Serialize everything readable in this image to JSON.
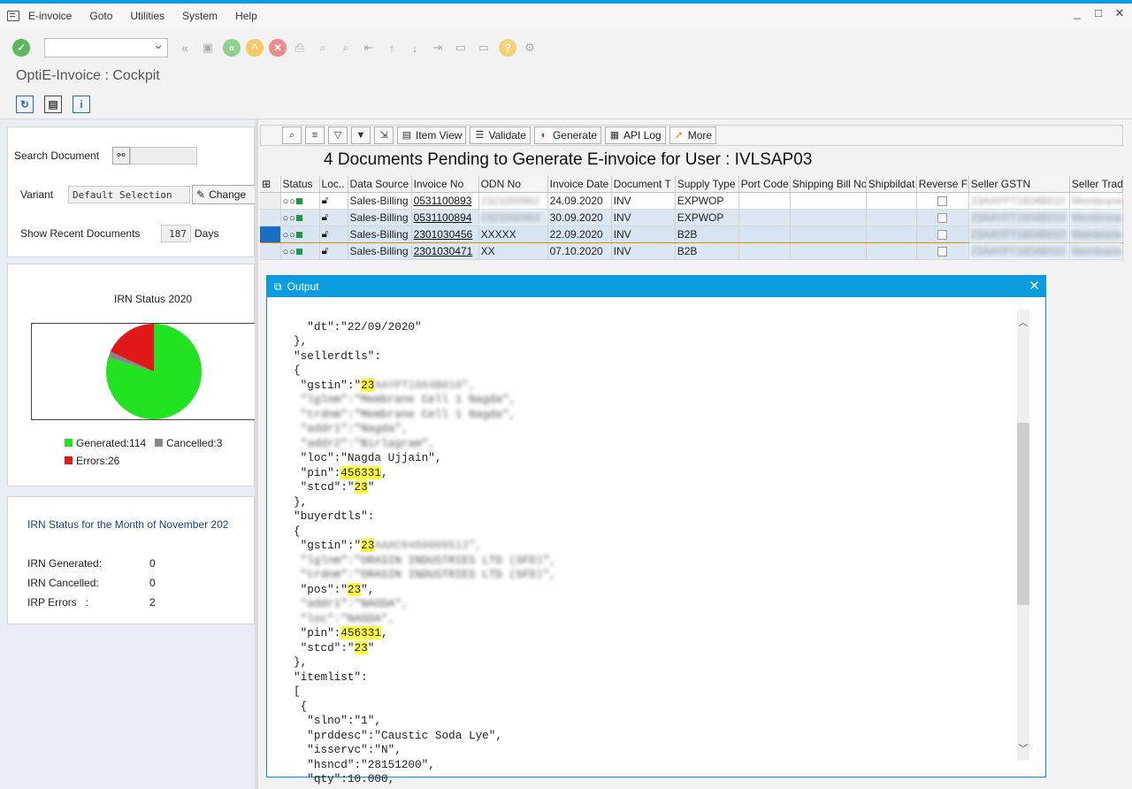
{
  "menu": {
    "items": [
      "E-invoice",
      "Goto",
      "Utilities",
      "System",
      "Help"
    ]
  },
  "window_controls": [
    "_",
    "□",
    "✕"
  ],
  "app_title": "OptiE-Invoice : Cockpit",
  "search": {
    "search_document_label": "Search Document",
    "variant_label": "Variant",
    "variant_value": "Default Selection",
    "change_label": "Change",
    "recent_label": "Show Recent Documents",
    "recent_value": "187",
    "days_label": "Days"
  },
  "irn_chart": {
    "legend_generated": "Generated:114",
    "legend_cancelled": "Cancelled:3",
    "legend_errors": "Errors:26"
  },
  "chart_data": {
    "type": "pie",
    "title": "IRN Status 2020",
    "series": [
      {
        "name": "Generated",
        "value": 114,
        "color": "#22e322"
      },
      {
        "name": "Cancelled",
        "value": 3,
        "color": "#888888"
      },
      {
        "name": "Errors",
        "value": 26,
        "color": "#e01818"
      }
    ]
  },
  "month_status": {
    "title": "IRN Status for the Month of November 202",
    "generated_label": "IRN Generated:",
    "generated_value": "0",
    "cancelled_label": "IRN Cancelled:",
    "cancelled_value": "0",
    "errors_label": "IRP Errors   :",
    "errors_value": "2"
  },
  "alv_toolbar": {
    "item_view": "Item View",
    "validate": "Validate",
    "generate": "Generate",
    "api_log": "API Log",
    "more": "More"
  },
  "grid": {
    "title": "4 Documents Pending to Generate E-invoice for User : IVLSAP03",
    "columns": [
      "Status",
      "Loc..",
      "Data Source",
      "Invoice No",
      "ODN No",
      "Invoice Date",
      "Document T",
      "Supply Type",
      "Port Code",
      "Shipping Bill No",
      "Shipbildat",
      "Reverse Fl",
      "Seller GSTN",
      "Seller Trad"
    ],
    "rows": [
      {
        "source": "Sales-Billing",
        "invoice": "0531100893",
        "odn": "2321000962",
        "date": "24.09.2020",
        "doc": "INV",
        "supply": "EXPWOP",
        "gstn": "23AAYPT1804B010",
        "trade": "Membrane"
      },
      {
        "source": "Sales-Billing",
        "invoice": "0531100894",
        "odn": "2321000963",
        "date": "30.09.2020",
        "doc": "INV",
        "supply": "EXPWOP",
        "gstn": "23AAYPT1804B010",
        "trade": "Membrane"
      },
      {
        "source": "Sales-Billing",
        "invoice": "2301030456",
        "odn": "XXXXX",
        "date": "22.09.2020",
        "doc": "INV",
        "supply": "B2B",
        "gstn": "23AAYPT1804B010",
        "trade": "Membrane"
      },
      {
        "source": "Sales-Billing",
        "invoice": "2301030471",
        "odn": "XX",
        "date": "07.10.2020",
        "doc": "INV",
        "supply": "B2B",
        "gstn": "23AAYPT1804B010",
        "trade": "Membrane"
      }
    ]
  },
  "dialog": {
    "title": "Output",
    "json_lines": [
      "  \"dt\":\"22/09/2020\"",
      "},",
      "\"sellerdtls\":",
      "{",
      " \"gstin\":\"",
      " \"lglnm\":\"Membrane Cell 1 Nagda\",",
      " \"trdnm\":\"Membrane Cell 1 Nagda\",",
      " \"addr1\":\"Nagda\",",
      " \"addr2\":\"Birlagram\",",
      " \"loc\":\"Nagda Ujjain\",",
      " \"pin\":",
      " \"stcd\":\"",
      "},",
      "\"buyerdtls\":",
      "{",
      " \"gstin\":\"",
      " \"lglnm\":\"ORASIN INDUSTRIES LTD (SFD)\",",
      " \"trdnm\":\"ORASIN INDUSTRIES LTD (SFD)\",",
      " \"pos\":\"",
      " \"addr1\":\"NAGDA\",",
      " \"loc\":\"NAGDA\",",
      " \"pin\":",
      " \"stcd\":\"",
      "},",
      "\"itemlist\":",
      "[",
      " {",
      "  \"slno\":\"1\",",
      "  \"prddesc\":\"Caustic Soda Lye\",",
      "  \"isservc\":\"N\",",
      "  \"hsncd\":\"28151200\",",
      "  \"qty\":10.000,"
    ],
    "hl_23": "23",
    "hl_pin": "456331",
    "seller_gstin_rest": "AAYPT1804B010\",",
    "buyer_gstin_rest": "AAAC0460009512\","
  }
}
